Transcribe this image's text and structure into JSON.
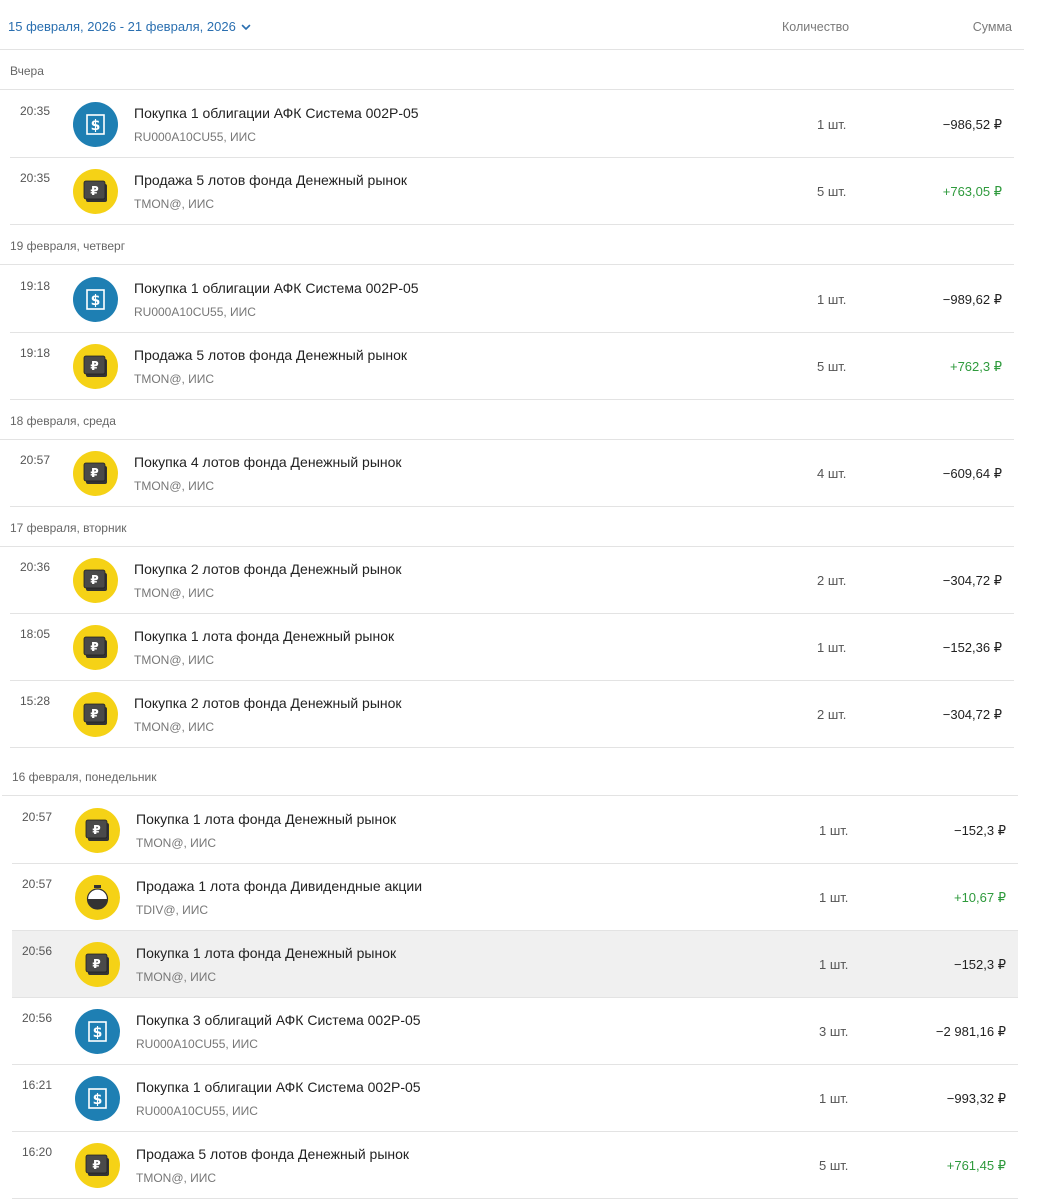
{
  "header": {
    "date_range": "15 февраля, 2026 - 21 февраля, 2026",
    "col_quantity": "Количество",
    "col_sum": "Сумма"
  },
  "colors": {
    "accent": "#2a6fb0",
    "positive": "#2e9a3c",
    "bond_icon": "#1e7fb3",
    "fund_icon": "#f5d216"
  },
  "groups": [
    {
      "label": "Вчера",
      "rows": [
        {
          "time": "20:35",
          "icon": "bond",
          "title": "Покупка 1 облигации АФК Система 002Р-05",
          "sub": "RU000A10CU55, ИИС",
          "qty": "1 шт.",
          "sum": "−986,52 ₽",
          "positive": false
        },
        {
          "time": "20:35",
          "icon": "fund-rub",
          "title": "Продажа 5 лотов фонда Денежный рынок",
          "sub": "TMON@, ИИС",
          "qty": "5 шт.",
          "sum": "+763,05 ₽",
          "positive": true
        }
      ]
    },
    {
      "label": "19 февраля, четверг",
      "rows": [
        {
          "time": "19:18",
          "icon": "bond",
          "title": "Покупка 1 облигации АФК Система 002Р-05",
          "sub": "RU000A10CU55, ИИС",
          "qty": "1 шт.",
          "sum": "−989,62 ₽",
          "positive": false
        },
        {
          "time": "19:18",
          "icon": "fund-rub",
          "title": "Продажа 5 лотов фонда Денежный рынок",
          "sub": "TMON@, ИИС",
          "qty": "5 шт.",
          "sum": "+762,3 ₽",
          "positive": true
        }
      ]
    },
    {
      "label": "18 февраля, среда",
      "rows": [
        {
          "time": "20:57",
          "icon": "fund-rub",
          "title": "Покупка 4 лотов фонда Денежный рынок",
          "sub": "TMON@, ИИС",
          "qty": "4 шт.",
          "sum": "−609,64 ₽",
          "positive": false
        }
      ]
    },
    {
      "label": "17 февраля, вторник",
      "rows": [
        {
          "time": "20:36",
          "icon": "fund-rub",
          "title": "Покупка 2 лотов фонда Денежный рынок",
          "sub": "TMON@, ИИС",
          "qty": "2 шт.",
          "sum": "−304,72 ₽",
          "positive": false
        },
        {
          "time": "18:05",
          "icon": "fund-rub",
          "title": "Покупка 1 лота фонда Денежный рынок",
          "sub": "TMON@, ИИС",
          "qty": "1 шт.",
          "sum": "−152,36 ₽",
          "positive": false
        },
        {
          "time": "15:28",
          "icon": "fund-rub",
          "title": "Покупка 2 лотов фонда Денежный рынок",
          "sub": "TMON@, ИИС",
          "qty": "2 шт.",
          "sum": "−304,72 ₽",
          "positive": false
        }
      ]
    },
    {
      "label": "16 февраля, понедельник",
      "rows": [
        {
          "time": "20:57",
          "icon": "fund-rub",
          "title": "Покупка 1 лота фонда Денежный рынок",
          "sub": "TMON@, ИИС",
          "qty": "1 шт.",
          "sum": "−152,3 ₽",
          "positive": false
        },
        {
          "time": "20:57",
          "icon": "fund-div",
          "title": "Продажа 1 лота фонда Дивидендные акции",
          "sub": "TDIV@, ИИС",
          "qty": "1 шт.",
          "sum": "+10,67 ₽",
          "positive": true
        },
        {
          "time": "20:56",
          "icon": "fund-rub",
          "title": "Покупка 1 лота фонда Денежный рынок",
          "sub": "TMON@, ИИС",
          "qty": "1 шт.",
          "sum": "−152,3 ₽",
          "positive": false,
          "highlighted": true
        },
        {
          "time": "20:56",
          "icon": "bond",
          "title": "Покупка 3 облигаций АФК Система 002Р-05",
          "sub": "RU000A10CU55, ИИС",
          "qty": "3 шт.",
          "sum": "−2 981,16 ₽",
          "positive": false
        },
        {
          "time": "16:21",
          "icon": "bond",
          "title": "Покупка 1 облигации АФК Система 002Р-05",
          "sub": "RU000A10CU55, ИИС",
          "qty": "1 шт.",
          "sum": "−993,32 ₽",
          "positive": false
        },
        {
          "time": "16:20",
          "icon": "fund-rub",
          "title": "Продажа 5 лотов фонда Денежный рынок",
          "sub": "TMON@, ИИС",
          "qty": "5 шт.",
          "sum": "+761,45 ₽",
          "positive": true
        }
      ]
    }
  ]
}
